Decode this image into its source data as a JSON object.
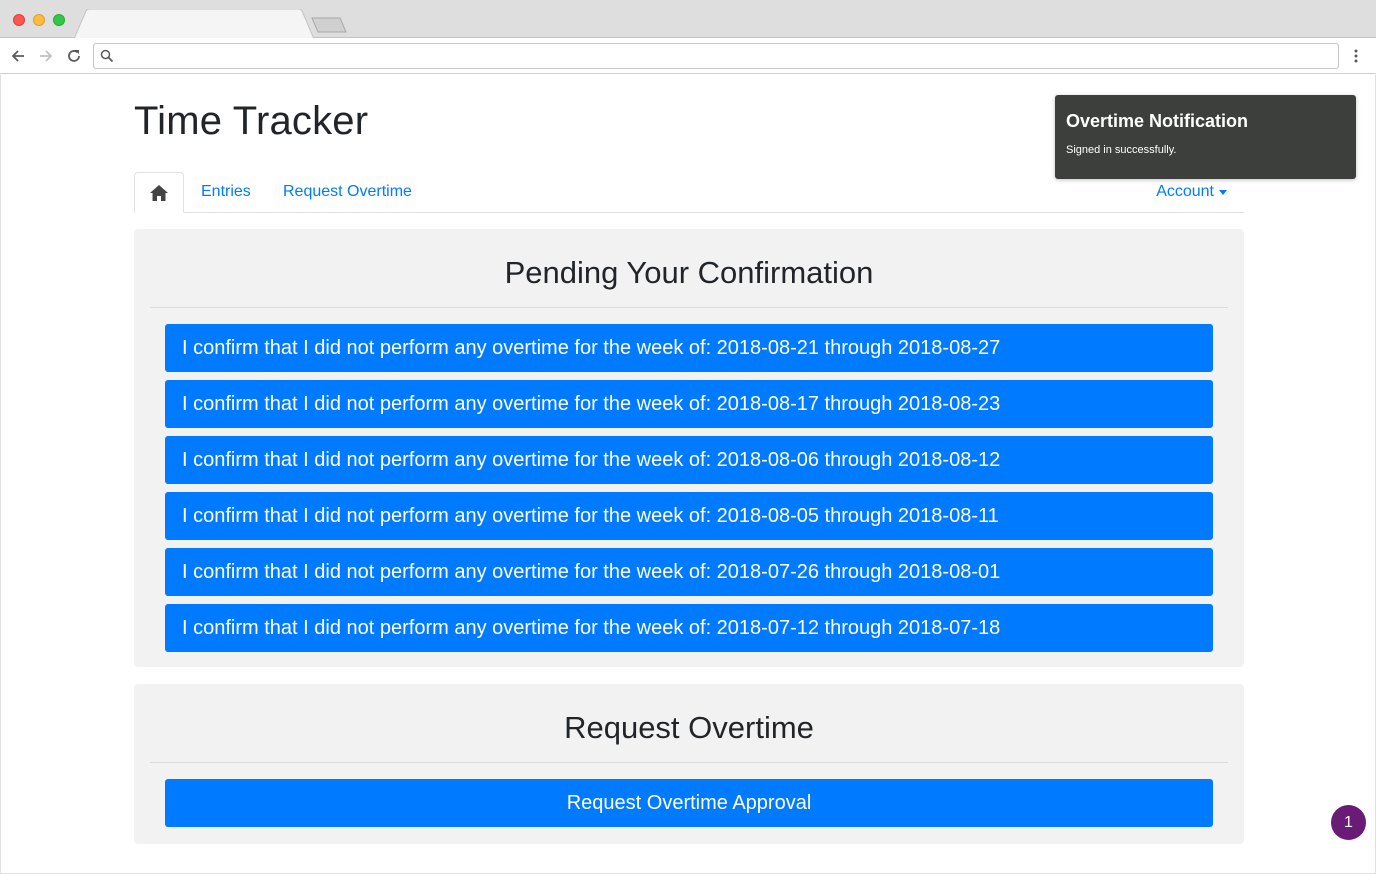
{
  "browser": {
    "address_value": "",
    "icons": {
      "back": "arrow-left-icon",
      "forward": "arrow-right-icon",
      "reload": "reload-icon",
      "search": "search-icon",
      "menu": "more-vertical-icon"
    }
  },
  "app": {
    "title": "Time Tracker"
  },
  "nav": {
    "home_icon": "home-icon",
    "items": [
      {
        "label": "Entries"
      },
      {
        "label": "Request Overtime"
      }
    ],
    "account_label": "Account"
  },
  "pending": {
    "title": "Pending Your Confirmation",
    "items": [
      {
        "label": "I confirm that I did not perform any overtime for the week of: 2018-08-21 through 2018-08-27"
      },
      {
        "label": "I confirm that I did not perform any overtime for the week of: 2018-08-17 through 2018-08-23"
      },
      {
        "label": "I confirm that I did not perform any overtime for the week of: 2018-08-06 through 2018-08-12"
      },
      {
        "label": "I confirm that I did not perform any overtime for the week of: 2018-08-05 through 2018-08-11"
      },
      {
        "label": "I confirm that I did not perform any overtime for the week of: 2018-07-26 through 2018-08-01"
      },
      {
        "label": "I confirm that I did not perform any overtime for the week of: 2018-07-12 through 2018-07-18"
      }
    ]
  },
  "request": {
    "title": "Request Overtime",
    "button_label": "Request Overtime Approval"
  },
  "toast": {
    "title": "Overtime Notification",
    "message": "Signed in successfully."
  },
  "badge": {
    "count": "1"
  },
  "colors": {
    "primary": "#007bff",
    "panel": "#f2f2f2",
    "toast": "#3d3f3d",
    "badge": "#6a1b75"
  }
}
